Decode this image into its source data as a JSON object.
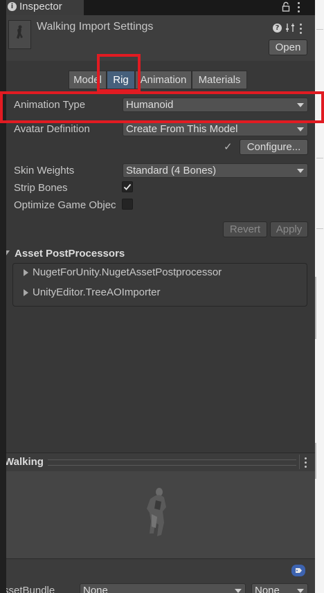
{
  "tab": {
    "title": "Inspector"
  },
  "header": {
    "title": "Walking Import Settings",
    "open_label": "Open"
  },
  "tabs": [
    "Model",
    "Rig",
    "Animation",
    "Materials"
  ],
  "rig": {
    "animation_type_label": "Animation Type",
    "animation_type_value": "Humanoid",
    "avatar_definition_label": "Avatar Definition",
    "avatar_definition_value": "Create From This Model",
    "configure_check": "✓",
    "configure_label": "Configure...",
    "skin_weights_label": "Skin Weights",
    "skin_weights_value": "Standard (4 Bones)",
    "strip_bones_label": "Strip Bones",
    "strip_bones_checked": true,
    "optimize_label": "Optimize Game Objec",
    "optimize_checked": false,
    "revert_label": "Revert",
    "apply_label": "Apply"
  },
  "postprocessors": {
    "title": "Asset PostProcessors",
    "items": [
      "NugetForUnity.NugetAssetPostprocessor",
      "UnityEditor.TreeAOImporter"
    ]
  },
  "preview": {
    "title": "Walking"
  },
  "assetbundle": {
    "label": "ssetBundle",
    "value1": "None",
    "value2": "None"
  },
  "colors": {
    "highlight": "#e11b22",
    "active_tab": "#46607c",
    "panel_bg": "#383838"
  }
}
